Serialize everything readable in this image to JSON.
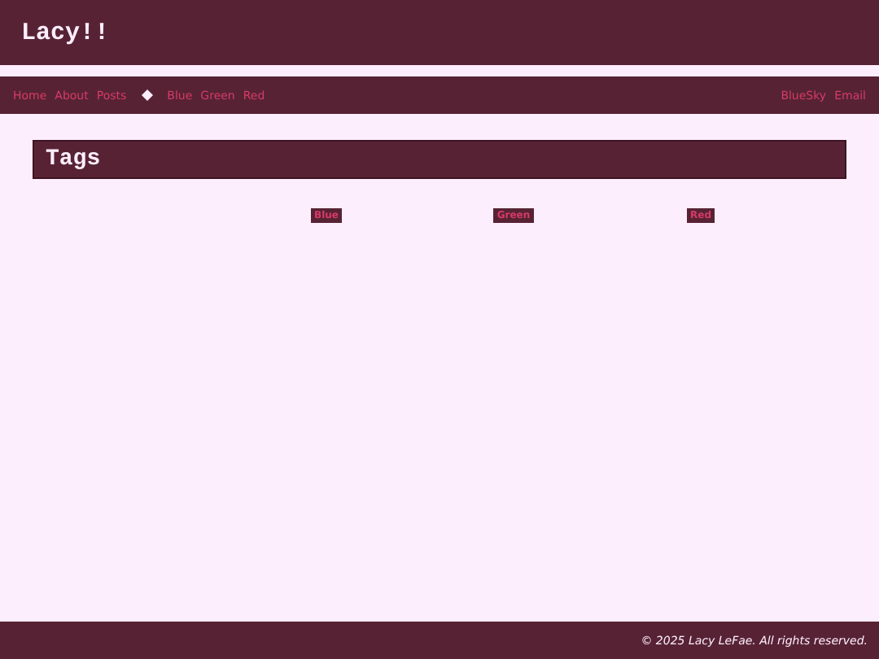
{
  "site_title": "Lacy!!",
  "nav": {
    "links": [
      "Home",
      "About",
      "Posts"
    ],
    "tags": [
      "Blue",
      "Green",
      "Red"
    ],
    "external": [
      "BlueSky",
      "Email"
    ]
  },
  "page_heading": "Tags",
  "tags": [
    "Blue",
    "Green",
    "Red"
  ],
  "footer": "© 2025 Lacy LeFae. All rights reserved."
}
